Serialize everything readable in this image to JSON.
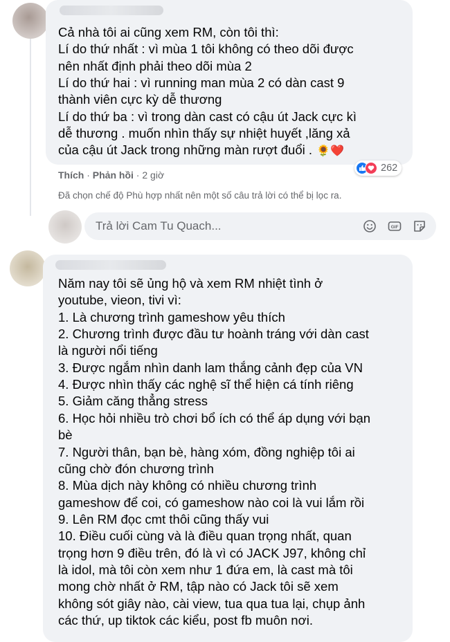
{
  "comment1": {
    "lines": [
      "Cả nhà tôi ai cũng xem RM, còn tôi thì:",
      "Lí do thứ nhất : vì mùa 1 tôi không có theo dõi được",
      "nên nhất định phải theo dõi mùa 2",
      "Lí do thứ hai : vì running man mùa 2 có dàn cast 9",
      "thành viên cực kỳ dễ thương",
      "Lí do thứ ba : vì trong dàn cast có cậu út Jack cực kì",
      "dễ thương . muốn nhìn thấy sự nhiệt huyết ,lăng xả",
      "của cậu út Jack trong những màn rượt đuổi ."
    ],
    "emojis": "🌻❤️",
    "like": "Thích",
    "reply": "Phản hồi",
    "time": "2 giờ",
    "reaction_count": "262"
  },
  "filter_note": "Đã chọn chế độ Phù hợp nhất nên một số câu trả lời có thể bị lọc ra.",
  "reply_box": {
    "placeholder": "Trả lời Cam Tu Quach...",
    "icons": [
      "emoji-icon",
      "gif-icon",
      "sticker-icon"
    ]
  },
  "comment2": {
    "lines": [
      "Năm nay tôi sẽ ủng hộ và xem RM nhiệt tình ở",
      "youtube, vieon, tivi vì:",
      "1. Là chương trình gameshow yêu thích",
      "2. Chương trình được đầu tư hoành tráng với dàn cast",
      "là người nổi tiếng",
      "3. Được ngắm nhìn danh lam thắng cảnh đẹp của VN",
      "4. Được nhìn thấy các nghệ sĩ thể hiện cá tính riêng",
      "5. Giảm căng thẳng stress",
      "6. Học hỏi nhiều trò chơi bổ ích có thể áp dụng với bạn",
      "bè",
      "7. Người thân, bạn bè, hàng xóm, đồng nghiệp tôi ai",
      "cũng chờ đón chương trình",
      "8. Mùa dịch này không có nhiều chương trình",
      "gameshow để coi, có gameshow nào coi là vui lắm rồi",
      "9. Lên RM đọc cmt thôi cũng thấy vui",
      "10. Điều cuối cùng và là điều quan trọng nhất, quan",
      "trọng hơn 9 điều trên, đó là vì có JACK J97, không chỉ",
      "là idol, mà tôi còn xem như 1 đứa em, là cast mà tôi",
      "mong chờ nhất ở RM, tập nào có Jack tôi sẽ xem",
      "không sót giây nào, cài view, tua qua tua lại, chụp ảnh",
      "các thứ, up tiktok các kiểu, post fb muôn nơi."
    ]
  }
}
